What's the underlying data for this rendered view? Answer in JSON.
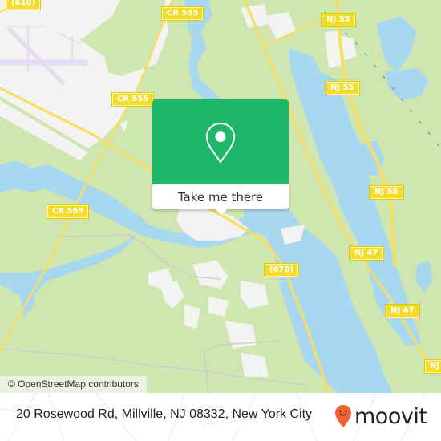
{
  "map": {
    "colors": {
      "land": "#cfe6b1",
      "water": "#a8d8ef",
      "urban": "#f3f3f1",
      "road": "#f7dd63",
      "airport": "#e6dcf5",
      "accent": "#1fb86a"
    },
    "road_labels": [
      {
        "id": "610",
        "text": "(610)"
      },
      {
        "id": "cr555-top",
        "text": "CR 555"
      },
      {
        "id": "cr555-mid",
        "text": "CR 555"
      },
      {
        "id": "cr555-left",
        "text": "CR 555"
      },
      {
        "id": "nj55-top",
        "text": "NJ 55"
      },
      {
        "id": "nj55-mid",
        "text": "NJ 55"
      },
      {
        "id": "nj55-right",
        "text": "NJ 55"
      },
      {
        "id": "670",
        "text": "(670)"
      },
      {
        "id": "nj47-top",
        "text": "NJ 47"
      },
      {
        "id": "nj47-mid",
        "text": "NJ 47"
      },
      {
        "id": "nj-bottom",
        "text": "NJ"
      }
    ],
    "attribution": "© OpenStreetMap contributors"
  },
  "popup": {
    "icon": "location-pin-icon",
    "button_label": "Take me there"
  },
  "footer": {
    "address": "20 Rosewood Rd, Millville, NJ 08332, New York City",
    "brand": "moovit",
    "brand_color": "#f26234"
  }
}
